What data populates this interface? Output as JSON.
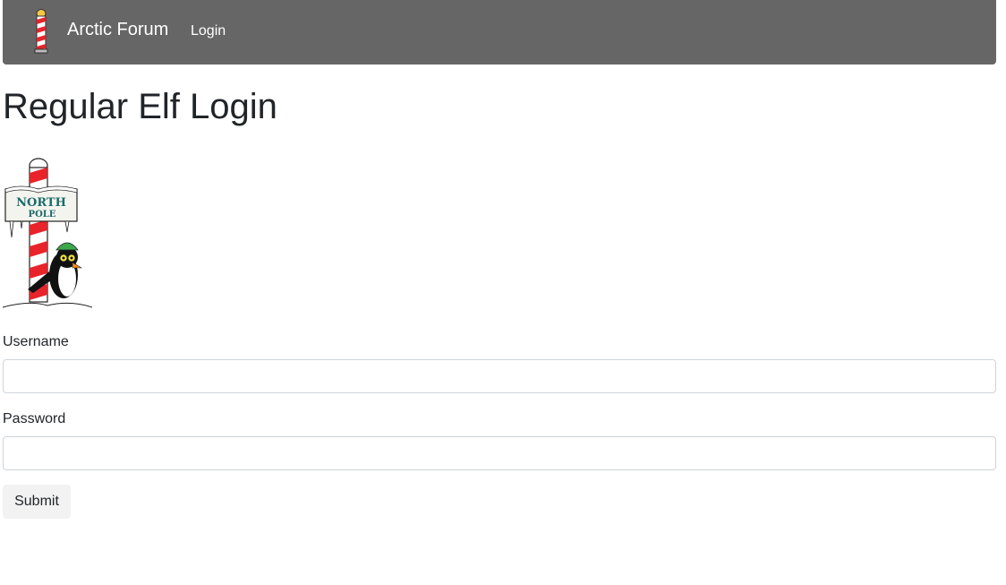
{
  "navbar": {
    "brand_title": "Arctic Forum",
    "brand_icon": "candy-cane-pole-icon",
    "login_link": "Login"
  },
  "page": {
    "title": "Regular Elf Login",
    "image": {
      "description_icon": "north-pole-penguin-image",
      "sign_text_line1": "NORTH",
      "sign_text_line2": "POLE"
    }
  },
  "form": {
    "username_label": "Username",
    "username_value": "",
    "password_label": "Password",
    "password_value": "",
    "submit_label": "Submit"
  },
  "colors": {
    "navbar_bg": "#666666",
    "pole_red": "#e8232a",
    "text": "#212529"
  }
}
